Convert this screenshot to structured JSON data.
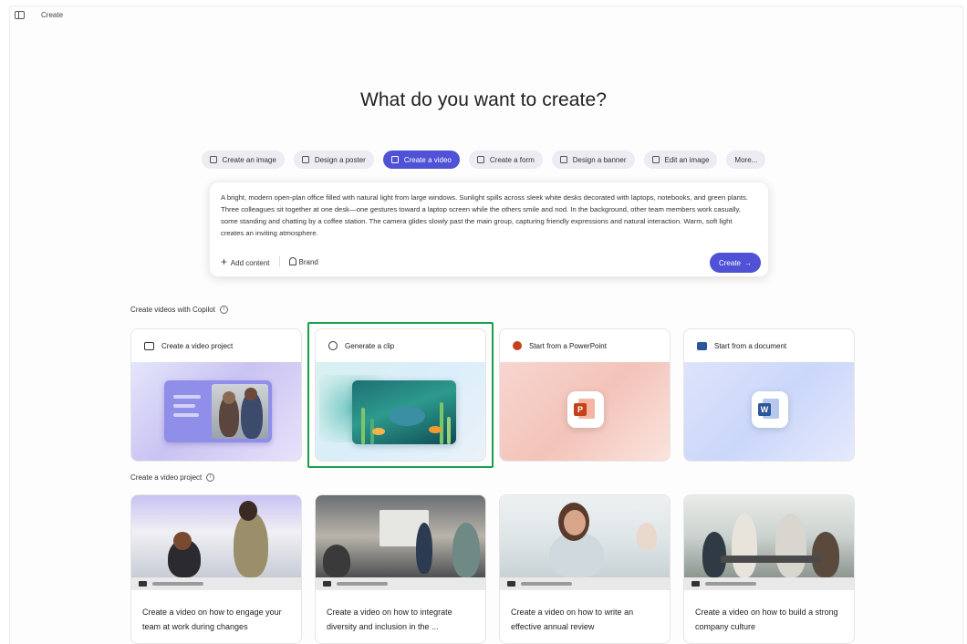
{
  "topbar": {
    "crumb": "Create"
  },
  "heading": "What do you want to create?",
  "chips": [
    {
      "label": "Create an image",
      "icon": "image-icon",
      "active": false
    },
    {
      "label": "Design a poster",
      "icon": "poster-icon",
      "active": false
    },
    {
      "label": "Create a video",
      "icon": "video-icon",
      "active": true
    },
    {
      "label": "Create a form",
      "icon": "form-icon",
      "active": false
    },
    {
      "label": "Design a banner",
      "icon": "banner-icon",
      "active": false
    },
    {
      "label": "Edit an image",
      "icon": "edit-image-icon",
      "active": false
    },
    {
      "label": "More...",
      "icon": "",
      "active": false
    }
  ],
  "prompt": {
    "text": "A bright, modern open-plan office filled with natural light from large windows. Sunlight spills across sleek white desks decorated with laptops, notebooks, and green plants. Three colleagues sit together at one desk—one gestures toward a laptop screen while the others smile and nod. In the background, other team members work casually, some standing and chatting by a coffee station. The camera glides slowly past the main group, capturing friendly expressions and natural interaction. Warm, soft light creates an inviting atmosphere.",
    "add_content": "Add content",
    "brand": "Brand",
    "create": "Create"
  },
  "section_copilot": {
    "label": "Create videos with Copilot"
  },
  "cards": [
    {
      "label": "Create a video project",
      "icon": "video-project-icon"
    },
    {
      "label": "Generate a clip",
      "icon": "clip-icon"
    },
    {
      "label": "Start from a PowerPoint",
      "icon": "powerpoint-icon"
    },
    {
      "label": "Start from a document",
      "icon": "word-icon"
    }
  ],
  "section_project": {
    "label": "Create a video project"
  },
  "templates": [
    {
      "caption": "Create a video on how to engage your team at work during changes"
    },
    {
      "caption": "Create a video on how to integrate diversity and inclusion in the ..."
    },
    {
      "caption": "Create a video on how to write an effective annual review"
    },
    {
      "caption": "Create a video on how to build a strong company culture"
    }
  ],
  "colors": {
    "accent": "#4f52d6",
    "highlight": "#1aa04a"
  }
}
